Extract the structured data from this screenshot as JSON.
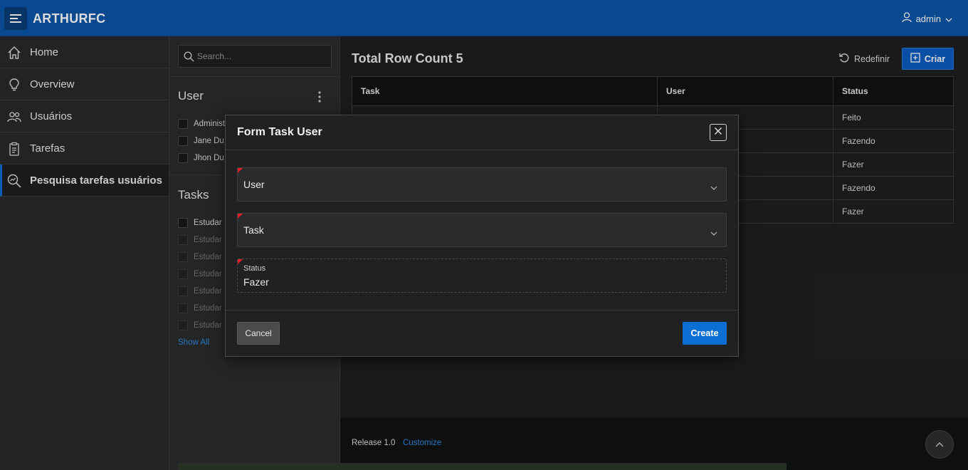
{
  "header": {
    "app_title": "ARTHURFC",
    "user_label": "admin",
    "menu_icon": "hamburger-icon",
    "user_icon": "user-icon"
  },
  "nav": {
    "items": [
      {
        "label": "Home",
        "icon": "home-icon"
      },
      {
        "label": "Overview",
        "icon": "lightbulb-icon"
      },
      {
        "label": "Usuários",
        "icon": "users-icon"
      },
      {
        "label": "Tarefas",
        "icon": "clipboard-icon"
      },
      {
        "label": "Pesquisa tarefas usuários",
        "icon": "search-chart-icon",
        "active": true
      }
    ]
  },
  "facets": {
    "search_placeholder": "Search...",
    "user_facet": {
      "title": "User",
      "options": [
        "Administ",
        "Jane Du",
        "Jhon Du"
      ]
    },
    "tasks_facet": {
      "title": "Tasks",
      "options": [
        "Estudar",
        "Estudar",
        "Estudar",
        "Estudar",
        "Estudar",
        "Estudar",
        "Estudar"
      ],
      "show_all": "Show All"
    }
  },
  "main": {
    "row_count_title": "Total Row Count 5",
    "reset_label": "Redefinir",
    "create_label": "Criar",
    "table": {
      "columns": [
        "Task",
        "User",
        "Status"
      ],
      "rows": [
        [
          "",
          "",
          "Feito"
        ],
        [
          "",
          "",
          "Fazendo"
        ],
        [
          "",
          "",
          "Fazer"
        ],
        [
          "",
          "",
          "Fazendo"
        ],
        [
          "",
          "",
          "Fazer"
        ]
      ]
    }
  },
  "footer": {
    "release": "Release 1.0",
    "customize": "Customize"
  },
  "dialog": {
    "title": "Form Task User",
    "user_field": "User",
    "task_field": "Task",
    "status_label": "Status",
    "status_value": "Fazer",
    "cancel_label": "Cancel",
    "create_label": "Create"
  },
  "colors": {
    "header_bg": "#0b56a8",
    "accent": "#0b6fd4",
    "required_flag": "#e0202a",
    "link": "#2f88e0"
  }
}
